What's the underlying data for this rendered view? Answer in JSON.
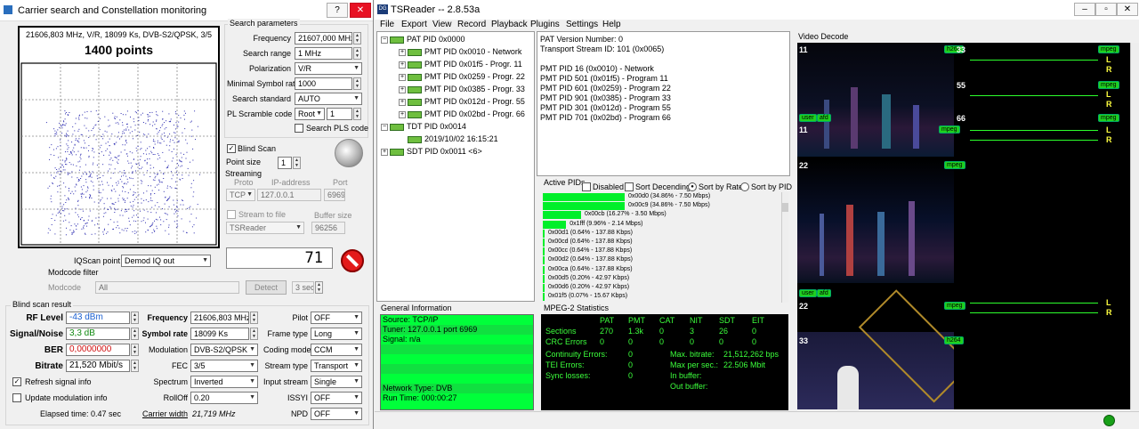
{
  "left": {
    "title": "Carrier search and Constellation monitoring",
    "help_btn": "?",
    "close_btn": "✕",
    "constellation": {
      "header": "21606,803 MHz, V/R, 18099 Ks, DVB-S2/QPSK, 3/5",
      "points_label": "1400 points"
    },
    "search": {
      "title": "Search parameters",
      "freq_label": "Frequency",
      "freq": "21607,000 MHz",
      "range_label": "Search range",
      "range": "1 MHz",
      "pol_label": "Polarization",
      "pol": "V/R",
      "minsym_label": "Minimal Symbol rate",
      "minsym": "1000",
      "std_label": "Search standard",
      "std": "AUTO",
      "pls_label": "PL Scramble code",
      "pls_mode": "Root",
      "pls_val": "1",
      "search_pls": "Search PLS code"
    },
    "blind": {
      "blind_scan": "Blind Scan",
      "point_size_label": "Point size",
      "point_size": "1"
    },
    "streaming": {
      "title": "Streaming",
      "proto_h": "Proto",
      "ip_h": "IP-address",
      "port_h": "Port",
      "proto": "TCP",
      "ip": "127.0.0.1",
      "port": "6969",
      "stream_file": "Stream to file",
      "buffer_h": "Buffer size",
      "reader": "TSReader",
      "buffer": "96256"
    },
    "iq_label": "IQScan point",
    "iq": "Demod IQ out",
    "display_val": "71",
    "modcode": {
      "title": "Modcode filter",
      "label": "Modcode",
      "value": "All",
      "detect": "Detect",
      "sec": "3 sec"
    },
    "result": {
      "title": "Blind scan result",
      "rflevel_l": "RF Level",
      "rflevel": "-43 dBm",
      "sn_l": "Signal/Noise",
      "sn": "3,3 dB",
      "ber_l": "BER",
      "ber": "0,0000000",
      "bitrate_l": "Bitrate",
      "bitrate": "21,520 Mbit/s",
      "freq_l": "Frequency",
      "freq": "21606,803 MHz",
      "sym_l": "Symbol rate",
      "sym": "18099 Ks",
      "mod_l": "Modulation",
      "mod": "DVB-S2/QPSK",
      "fec_l": "FEC",
      "fec": "3/5",
      "spec_l": "Spectrum",
      "spec": "Inverted",
      "roll_l": "RollOff",
      "roll": "0.20",
      "cw_l": "Carrier width",
      "cw": "21,719 MHz",
      "pilot_l": "Pilot",
      "pilot": "OFF",
      "frame_l": "Frame type",
      "frame": "Long",
      "coding_l": "Coding mode",
      "coding": "CCM",
      "stype_l": "Stream type",
      "stype": "Transport",
      "input_l": "Input stream",
      "input": "Single",
      "issyi_l": "ISSYI",
      "issyi": "OFF",
      "npd_l": "NPD",
      "npd": "OFF",
      "refresh": "Refresh signal info",
      "update": "Update modulation info",
      "elapsed": "Elapsed time: 0.47 sec"
    }
  },
  "right": {
    "title": "TSReader -- 2.8.53a",
    "menu": [
      "File",
      "Export",
      "View",
      "Record",
      "Playback",
      "Plugins",
      "Settings",
      "Help"
    ],
    "tree": [
      "PAT PID 0x0000",
      "PMT PID 0x0010 - Network",
      "PMT PID 0x01f5 - Progr. 11",
      "PMT PID 0x0259 - Progr. 22",
      "PMT PID 0x0385 - Progr. 33",
      "PMT PID 0x012d - Progr. 55",
      "PMT PID 0x02bd - Progr. 66",
      "TDT PID 0x0014",
      "2019/10/02 16:15:21",
      "SDT PID 0x0011 <6>"
    ],
    "pat_info": [
      "PAT Version Number: 0",
      "Transport Stream ID: 101 (0x0065)",
      "",
      "PMT PID 16 (0x0010) - Network",
      "PMT PID 501 (0x01f5) - Program 11",
      "PMT PID 601 (0x0259) - Program 22",
      "PMT PID 901 (0x0385) - Program 33",
      "PMT PID 301 (0x012d) - Program 55",
      "PMT PID 701 (0x02bd) - Program 66"
    ],
    "active": {
      "title": "Active PIDs",
      "disabled": "Disabled",
      "sort_desc": "Sort Decending",
      "sort_rate": "Sort by Rate",
      "sort_pid": "Sort by PID",
      "rows": [
        {
          "label": "0x00d0 (34.86% - 7.50 Mbps)",
          "pct": 34.86
        },
        {
          "label": "0x00c9 (34.86% - 7.50 Mbps)",
          "pct": 34.86
        },
        {
          "label": "0x00cb (16.27% - 3.50 Mbps)",
          "pct": 16.27
        },
        {
          "label": "0x1fff (9.96% - 2.14 Mbps)",
          "pct": 9.96
        },
        {
          "label": "0x00d1 (0.64% - 137.88 Kbps)",
          "pct": 0.64
        },
        {
          "label": "0x00cd (0.64% - 137.88 Kbps)",
          "pct": 0.64
        },
        {
          "label": "0x00cc (0.64% - 137.88 Kbps)",
          "pct": 0.64
        },
        {
          "label": "0x00d2 (0.64% - 137.88 Kbps)",
          "pct": 0.64
        },
        {
          "label": "0x00ca (0.64% - 137.88 Kbps)",
          "pct": 0.64
        },
        {
          "label": "0x00d5 (0.20% - 42.97 Kbps)",
          "pct": 0.2
        },
        {
          "label": "0x00d6 (0.20% - 42.97 Kbps)",
          "pct": 0.2
        },
        {
          "label": "0x01f5 (0.07% - 15.67 Kbps)",
          "pct": 0.07
        }
      ]
    },
    "general": {
      "title": "General Information",
      "lines": [
        "Source: TCP/IP",
        "Tuner: 127.0.0.1 port 6969",
        "Signal: n/a",
        "",
        "",
        "",
        "",
        "Network Type: DVB",
        "Run Time: 000:00:27"
      ]
    },
    "mpeg": {
      "title": "MPEG-2 Statistics",
      "headers": [
        "PAT",
        "PMT",
        "CAT",
        "NIT",
        "SDT",
        "EIT"
      ],
      "sections_l": "Sections",
      "sections": [
        "270",
        "1.3k",
        "0",
        "3",
        "26",
        "0"
      ],
      "crc_l": "CRC Errors",
      "crc": [
        "0",
        "0",
        "0",
        "0",
        "0",
        "0"
      ],
      "cont_l": "Continuity Errors:",
      "cont": "0",
      "tei_l": "TEI Errors:",
      "tei": "0",
      "sync_l": "Sync losses:",
      "sync": "0",
      "maxbit_l": "Max. bitrate:",
      "maxbit": "21,512,262 bps",
      "maxsec_l": "Max per sec.:",
      "maxsec": "22.506 Mbit",
      "inbuf_l": "In buffer:",
      "outbuf_l": "Out buffer:"
    },
    "video": {
      "title": "Video Decode",
      "tiles": [
        {
          "num": "11",
          "tag": "h264"
        },
        {
          "num": "33",
          "tag": "mpeg"
        },
        {
          "num": "55",
          "tag": "mpeg"
        },
        {
          "num": "66",
          "tag": "mpeg"
        },
        {
          "num": "11",
          "tag": "mpeg"
        },
        {
          "num": "22",
          "tag": "mpeg"
        },
        {
          "num": "22",
          "tag": "mpeg"
        },
        {
          "num": "33",
          "tag": "h264"
        }
      ],
      "user": "user",
      "afd": "afd",
      "L": "L",
      "R": "R"
    }
  }
}
